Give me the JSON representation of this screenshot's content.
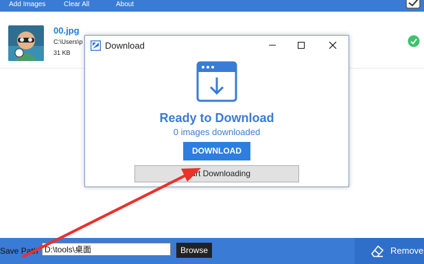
{
  "toolbar": {
    "add_images": "Add Images",
    "clear_all": "Clear All",
    "about": "About"
  },
  "file": {
    "name": "00.jpg",
    "path": "C:\\Users\\p",
    "size": "31 KB",
    "status_icon": "check-circle-icon"
  },
  "dialog": {
    "title": "Download",
    "heading": "Ready to Download",
    "count_text": "0 images downloaded",
    "download_button": "DOWNLOAD",
    "start_button": "Start Downloading"
  },
  "bottom": {
    "save_path_label": "Save Path",
    "save_path_value": "D:\\tools\\桌面",
    "browse_button": "Browse",
    "remove_button": "Remove"
  },
  "colors": {
    "accent": "#3a7bd5",
    "button": "#2e7de0",
    "annotation_arrow": "#e8322b",
    "success": "#3cc36b"
  }
}
